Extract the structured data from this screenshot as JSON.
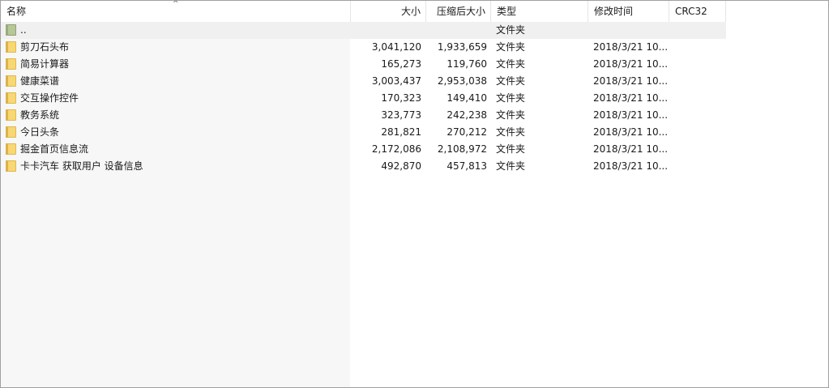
{
  "columns": {
    "name": "名称",
    "size": "大小",
    "packed": "压缩后大小",
    "type": "类型",
    "modified": "修改时间",
    "crc": "CRC32",
    "sort_indicator": "^"
  },
  "parent_row": {
    "name": "..",
    "type": "文件夹"
  },
  "rows": [
    {
      "name": "剪刀石头布",
      "size": "3,041,120",
      "packed": "1,933,659",
      "type": "文件夹",
      "modified": "2018/3/21 10..."
    },
    {
      "name": "简易计算器",
      "size": "165,273",
      "packed": "119,760",
      "type": "文件夹",
      "modified": "2018/3/21 10..."
    },
    {
      "name": "健康菜谱",
      "size": "3,003,437",
      "packed": "2,953,038",
      "type": "文件夹",
      "modified": "2018/3/21 10..."
    },
    {
      "name": "交互操作控件",
      "size": "170,323",
      "packed": "149,410",
      "type": "文件夹",
      "modified": "2018/3/21 10..."
    },
    {
      "name": "教务系统",
      "size": "323,773",
      "packed": "242,238",
      "type": "文件夹",
      "modified": "2018/3/21 10..."
    },
    {
      "name": "今日头条",
      "size": "281,821",
      "packed": "270,212",
      "type": "文件夹",
      "modified": "2018/3/21 10..."
    },
    {
      "name": "掘金首页信息流",
      "size": "2,172,086",
      "packed": "2,108,972",
      "type": "文件夹",
      "modified": "2018/3/21 10..."
    },
    {
      "name": "卡卡汽车 获取用户 设备信息",
      "size": "492,870",
      "packed": "457,813",
      "type": "文件夹",
      "modified": "2018/3/21 10..."
    }
  ],
  "icons": {
    "folder": "folder-icon",
    "parent_folder": "parent-folder-icon"
  }
}
